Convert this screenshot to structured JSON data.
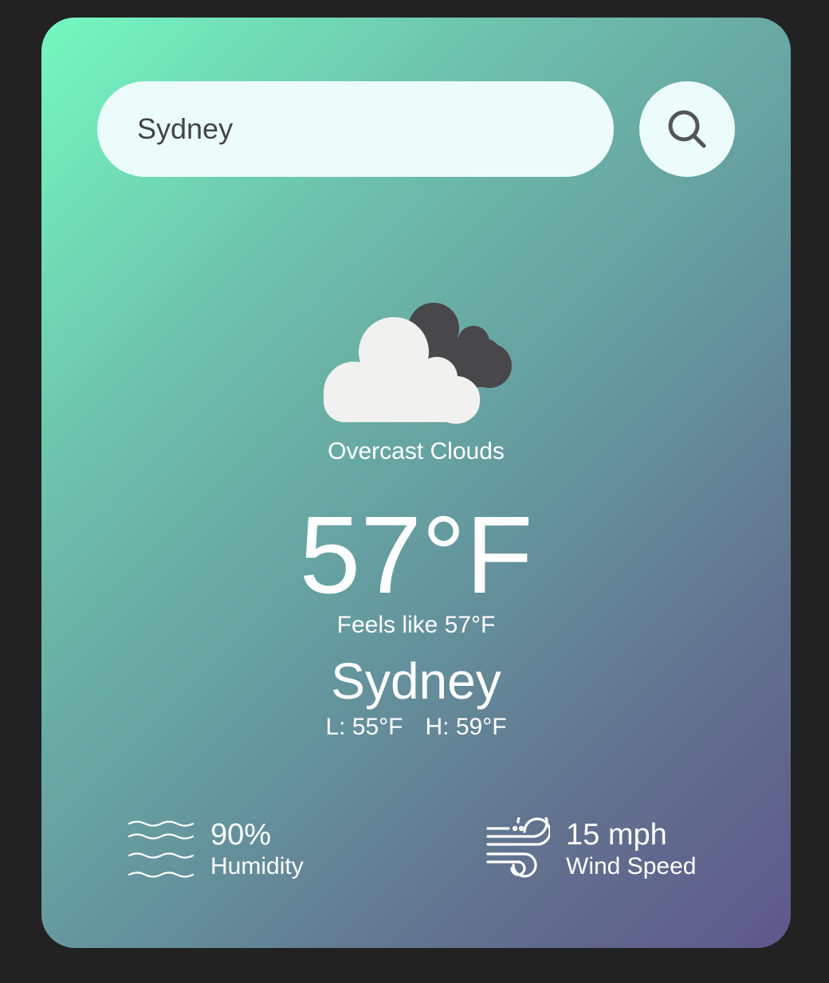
{
  "search": {
    "value": "Sydney",
    "icon": "search-icon"
  },
  "weather": {
    "icon": "overcast-clouds-icon",
    "condition": "Overcast Clouds",
    "temperature": "57°F",
    "feels_like": "Feels like 57°F",
    "city": "Sydney",
    "low": "L: 55°F",
    "high": "H: 59°F"
  },
  "stats": {
    "humidity": {
      "icon": "humidity-waves-icon",
      "value": "90%",
      "label": "Humidity"
    },
    "wind": {
      "icon": "wind-icon",
      "value": "15 mph",
      "label": "Wind Speed"
    }
  },
  "colors": {
    "page_background": "#222222",
    "gradient_start": "#74f8c0",
    "gradient_end": "#5e588a",
    "search_background": "#ebfcfb",
    "text": "#ffffff"
  }
}
